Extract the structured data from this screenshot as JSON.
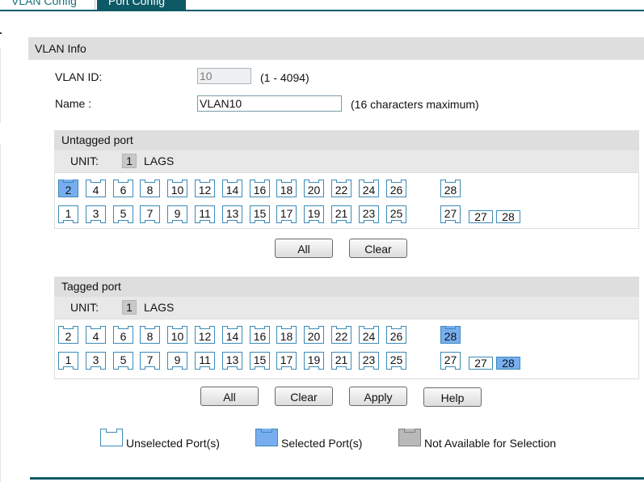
{
  "tabs": [
    {
      "label": "VLAN Config",
      "active": false
    },
    {
      "label": "Port Config",
      "active": true
    }
  ],
  "vlan_info": {
    "title": "VLAN Info",
    "vlan_id_label": "VLAN ID:",
    "vlan_id_value": "10",
    "vlan_id_hint": "(1 - 4094)",
    "name_label": "Name :",
    "name_value": "VLAN10",
    "name_hint": "(16 characters maximum)"
  },
  "untagged": {
    "title": "Untagged port",
    "unit_label": "UNIT:",
    "unit_value": "1",
    "lags_label": "LAGS",
    "top_ports": [
      "2",
      "4",
      "6",
      "8",
      "10",
      "12",
      "14",
      "16",
      "18",
      "20",
      "22",
      "24",
      "26"
    ],
    "top_extra": "28",
    "bottom_ports": [
      "1",
      "3",
      "5",
      "7",
      "9",
      "11",
      "13",
      "15",
      "17",
      "19",
      "21",
      "23",
      "25"
    ],
    "bottom_extra": "27",
    "lags": [
      "27",
      "28"
    ],
    "selected_ports": [
      "2"
    ],
    "selected_lags": [],
    "buttons": {
      "all": "All",
      "clear": "Clear"
    }
  },
  "tagged": {
    "title": "Tagged port",
    "unit_label": "UNIT:",
    "unit_value": "1",
    "lags_label": "LAGS",
    "top_ports": [
      "2",
      "4",
      "6",
      "8",
      "10",
      "12",
      "14",
      "16",
      "18",
      "20",
      "22",
      "24",
      "26"
    ],
    "top_extra": "28",
    "bottom_ports": [
      "1",
      "3",
      "5",
      "7",
      "9",
      "11",
      "13",
      "15",
      "17",
      "19",
      "21",
      "23",
      "25"
    ],
    "bottom_extra": "27",
    "lags": [
      "27",
      "28"
    ],
    "selected_ports": [
      "28"
    ],
    "selected_lags": [
      "28"
    ],
    "buttons": {
      "all": "All",
      "clear": "Clear",
      "apply": "Apply",
      "help": "Help"
    }
  },
  "legend": {
    "unselected": "Unselected Port(s)",
    "selected": "Selected Port(s)",
    "not_available": "Not Available for Selection"
  },
  "colors": {
    "accent": "#0d5a66",
    "port_border": "#3b8bb8",
    "port_selected": "#78aef0",
    "port_unavailable": "#b9b9b9"
  }
}
